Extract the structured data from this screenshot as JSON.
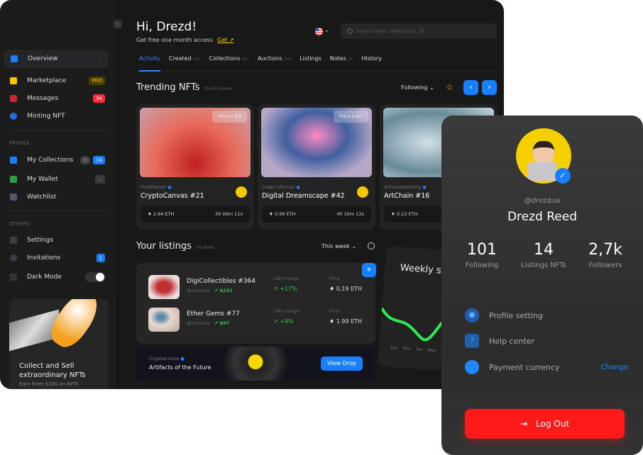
{
  "sidebar": {
    "items": [
      {
        "label": "Overview",
        "icon": "grid-icon",
        "color": "#1880ff"
      },
      {
        "label": "Marketplace",
        "icon": "cart-icon",
        "color": "#f5c800",
        "badge": "PRO"
      },
      {
        "label": "Messages",
        "icon": "mail-icon",
        "color": "#cc2233",
        "badge": "34"
      },
      {
        "label": "Minting NFT",
        "icon": "mint-icon",
        "color": "#1e6fe0"
      }
    ],
    "profile_section": "PROFILE",
    "profile_items": [
      {
        "label": "My Collections",
        "badge": "14"
      },
      {
        "label": "My Wallet"
      },
      {
        "label": "Watchlist"
      }
    ],
    "others_section": "OTHERS",
    "other_items": [
      {
        "label": "Settings"
      },
      {
        "label": "Invitations",
        "badge": "1"
      },
      {
        "label": "Dark Mode"
      }
    ],
    "promo": {
      "title": "Collect and Sell extraordinary NFTs",
      "subtitle": "Earn from $100 on NFTs"
    }
  },
  "header": {
    "greeting": "Hi, Drezd!",
    "subtitle": "Get free one month access",
    "get_link": "Get ↗",
    "search_placeholder": "Search item, collections, ID"
  },
  "tabs": [
    {
      "label": "Activity"
    },
    {
      "label": "Created",
      "count": "(47)"
    },
    {
      "label": "Collections",
      "count": "(65)"
    },
    {
      "label": "Auctions",
      "count": "(14)"
    },
    {
      "label": "Listings"
    },
    {
      "label": "Notes",
      "count": "(3)"
    },
    {
      "label": "History"
    }
  ],
  "trending": {
    "title": "Trending NFTs",
    "count": "15.455 items",
    "filter": "Following ⌄",
    "cards": [
      {
        "creator": "PixelPioneer",
        "title": "CryptoCanvas #21",
        "price": "2.84 ETH",
        "time": "5h 09m 11s",
        "bid": "Place a Bid"
      },
      {
        "creator": "CodeCraftsman",
        "title": "Digital Dreamscape #42",
        "price": "0,99 ETH",
        "time": "4h 16m 12s",
        "bid": "Place a Bid"
      },
      {
        "creator": "ArtisanalAlchemy",
        "title": "ArtChain #16",
        "price": "0,13 ETH",
        "time": ""
      }
    ]
  },
  "listings": {
    "title": "Your listings",
    "count": "14 items",
    "filter": "This week ⌄",
    "rows": [
      {
        "name": "DigiCollectibles #364",
        "user": "@drezdua",
        "gain": "↗ $231",
        "change_label": "24H change",
        "change": "↗ +17%",
        "price_label": "Price",
        "price": "0,19 ETH"
      },
      {
        "name": "Ether Gems #77",
        "user": "@drezdua",
        "gain": "↗ $97",
        "change_label": "24H change",
        "change": "↗ +9%",
        "price_label": "Price",
        "price": "1.99 ETH"
      }
    ]
  },
  "drop": {
    "creator": "CryptoCurios",
    "title": "Artifacts of the Future",
    "button": "View Drop"
  },
  "weekly": {
    "title": "Weekly stats",
    "days": [
      "Sun",
      "Mon",
      "Tue",
      "Wed"
    ]
  },
  "profile": {
    "handle": "@drezdua",
    "name": "Drezd Reed",
    "stats": [
      {
        "value": "101",
        "label": "Following"
      },
      {
        "value": "14",
        "label": "Listings NFTs"
      },
      {
        "value": "2,7k",
        "label": "Followers"
      }
    ],
    "menu": [
      {
        "label": "Profile setting",
        "icon": "user-icon"
      },
      {
        "label": "Help center",
        "icon": "help-icon"
      },
      {
        "label": "Payment currency",
        "icon": "currency-icon",
        "action": "Change"
      }
    ],
    "logout": "Log Out"
  },
  "colors": {
    "accent": "#1880ff",
    "danger": "#ff1a1a",
    "positive": "#2ecc55",
    "pro": "#f5c800"
  }
}
